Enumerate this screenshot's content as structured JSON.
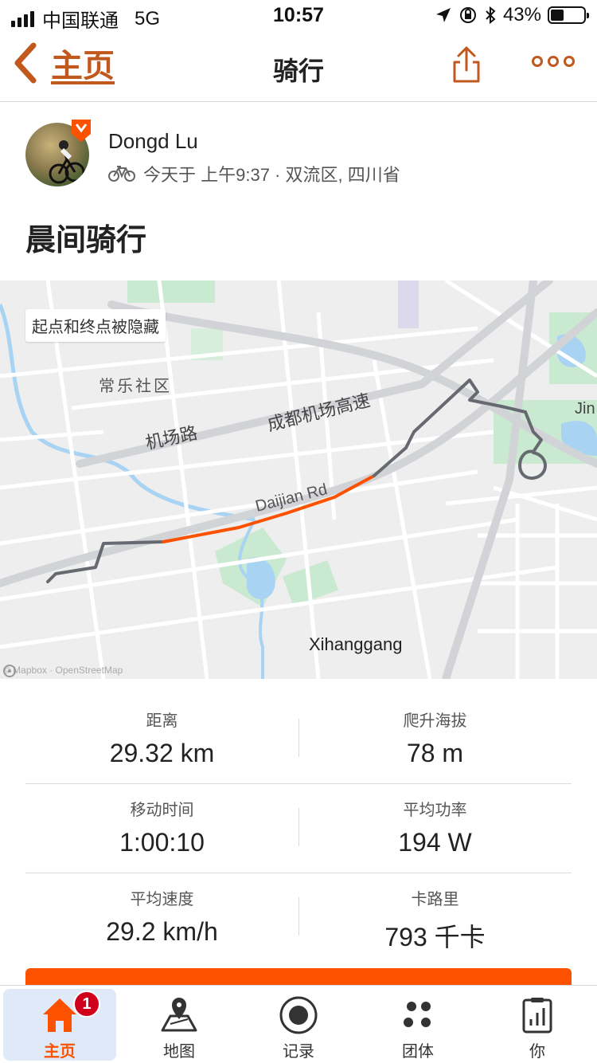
{
  "status_bar": {
    "carrier": "中国联通",
    "network": "5G",
    "time": "10:57",
    "battery": "43%"
  },
  "nav": {
    "back_label": "主页",
    "title": "骑行"
  },
  "activity": {
    "athlete_name": "Dongd Lu",
    "meta": "今天于 上午9:37 · 双流区, 四川省",
    "title": "晨间骑行"
  },
  "map": {
    "privacy_note": "起点和终点被隐藏",
    "labels": {
      "community": "常乐社区",
      "airport_road": "机场路",
      "expressway": "成都机场高速",
      "daijian_road": "Daijian Rd",
      "district": "Xihanggang",
      "jin": "Jin"
    },
    "attribution": "© Mapbox · OpenStreetMap",
    "colors": {
      "route": "#666a70",
      "highlight": "#fc5200",
      "park": "#c9ead0",
      "water": "#a9d3f2"
    }
  },
  "stats": [
    {
      "label": "距离",
      "value": "29.32 km"
    },
    {
      "label": "爬升海拔",
      "value": "78 m"
    },
    {
      "label": "移动时间",
      "value": "1:00:10"
    },
    {
      "label": "平均功率",
      "value": "194 W"
    },
    {
      "label": "平均速度",
      "value": "29.2 km/h"
    },
    {
      "label": "卡路里",
      "value": "793 千卡"
    }
  ],
  "tabbar": {
    "items": [
      {
        "label": "主页",
        "icon": "home-icon",
        "badge": "1"
      },
      {
        "label": "地图",
        "icon": "map-icon"
      },
      {
        "label": "记录",
        "icon": "record-icon"
      },
      {
        "label": "团体",
        "icon": "groups-icon"
      },
      {
        "label": "你",
        "icon": "you-icon"
      }
    ]
  },
  "accent_color": "#fc5200"
}
